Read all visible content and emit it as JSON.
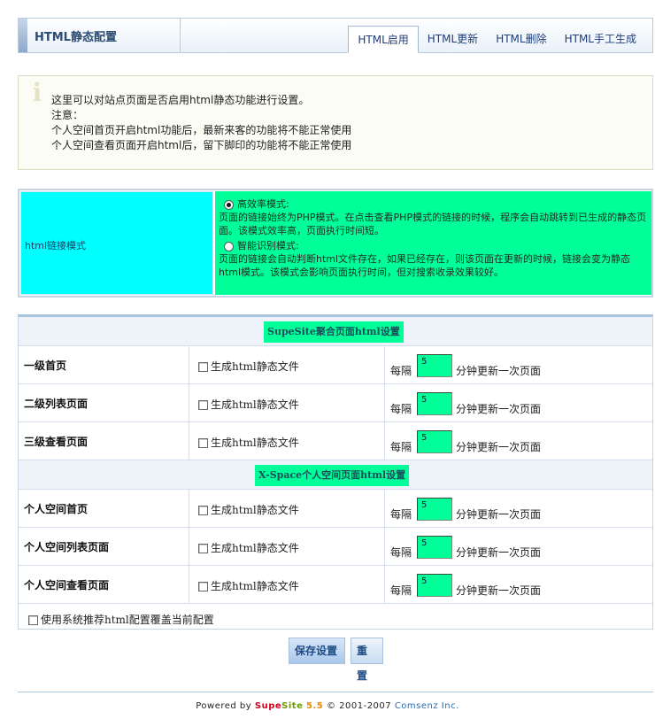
{
  "header": {
    "title": "HTML静态配置",
    "tabs": [
      "HTML启用",
      "HTML更新",
      "HTML删除",
      "HTML手工生成"
    ],
    "active_tab": "HTML启用"
  },
  "notice": {
    "lines": [
      "这里可以对站点页面是否启用html静态功能进行设置。",
      "注意：",
      "个人空间首页开启html功能后，最新来客的功能将不能正常使用",
      "个人空间查看页面开启html后，留下脚印的功能将不能正常使用"
    ]
  },
  "link_mode": {
    "label": "html链接模式",
    "options": [
      {
        "title": "高效率模式:",
        "selected": true,
        "desc": "页面的链接始终为PHP模式。在点击查看PHP模式的链接的时候，程序会自动跳转到已生成的静态页面。该模式效率高，页面执行时间短。"
      },
      {
        "title": "智能识别模式:",
        "selected": false,
        "desc": "页面的链接会自动判断html文件存在，如果已经存在，则该页面在更新的时候，链接会变为静态html模式。该模式会影响页面执行时间，但对搜索收录效果较好。"
      }
    ]
  },
  "sections": [
    {
      "title": "SupeSite聚合页面html设置",
      "rows": [
        {
          "name": "一级首页",
          "checkbox_label": "生成html静态文件",
          "checked": false,
          "every": "每隔",
          "minutes": "5",
          "per": "分钟更新一次页面"
        },
        {
          "name": "二级列表页面",
          "checkbox_label": "生成html静态文件",
          "checked": false,
          "every": "每隔",
          "minutes": "5",
          "per": "分钟更新一次页面"
        },
        {
          "name": "三级查看页面",
          "checkbox_label": "生成html静态文件",
          "checked": false,
          "every": "每隔",
          "minutes": "5",
          "per": "分钟更新一次页面"
        }
      ]
    },
    {
      "title": "X-Space个人空间页面html设置",
      "rows": [
        {
          "name": "个人空间首页",
          "checkbox_label": "生成html静态文件",
          "checked": false,
          "every": "每隔",
          "minutes": "5",
          "per": "分钟更新一次页面"
        },
        {
          "name": "个人空间列表页面",
          "checkbox_label": "生成html静态文件",
          "checked": false,
          "every": "每隔",
          "minutes": "5",
          "per": "分钟更新一次页面"
        },
        {
          "name": "个人空间查看页面",
          "checkbox_label": "生成html静态文件",
          "checked": false,
          "every": "每隔",
          "minutes": "5",
          "per": "分钟更新一次页面"
        }
      ]
    }
  ],
  "override_label": "使用系统推荐html配置覆盖当前配置",
  "buttons": {
    "save": "保存设置",
    "reset": "重置"
  },
  "footer": {
    "powered": "Powered by",
    "brand_a": "Supe",
    "brand_b": "Site",
    "version": "5.5",
    "copyright": "© 2001-2007",
    "company": "Comsenz Inc."
  },
  "colors": {
    "highlight_green": "#00ff99",
    "label_cyan": "#00ffff",
    "link_blue": "#1c3d7a"
  }
}
